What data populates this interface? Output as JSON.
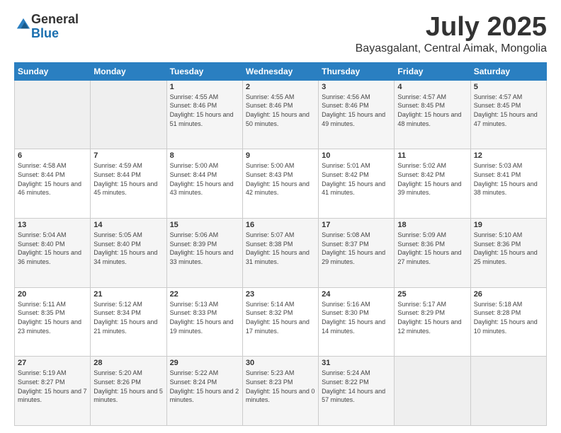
{
  "header": {
    "logo_general": "General",
    "logo_blue": "Blue",
    "month": "July 2025",
    "location": "Bayasgalant, Central Aimak, Mongolia"
  },
  "days_of_week": [
    "Sunday",
    "Monday",
    "Tuesday",
    "Wednesday",
    "Thursday",
    "Friday",
    "Saturday"
  ],
  "weeks": [
    [
      {
        "day": "",
        "sunrise": "",
        "sunset": "",
        "daylight": ""
      },
      {
        "day": "",
        "sunrise": "",
        "sunset": "",
        "daylight": ""
      },
      {
        "day": "1",
        "sunrise": "Sunrise: 4:55 AM",
        "sunset": "Sunset: 8:46 PM",
        "daylight": "Daylight: 15 hours and 51 minutes."
      },
      {
        "day": "2",
        "sunrise": "Sunrise: 4:55 AM",
        "sunset": "Sunset: 8:46 PM",
        "daylight": "Daylight: 15 hours and 50 minutes."
      },
      {
        "day": "3",
        "sunrise": "Sunrise: 4:56 AM",
        "sunset": "Sunset: 8:46 PM",
        "daylight": "Daylight: 15 hours and 49 minutes."
      },
      {
        "day": "4",
        "sunrise": "Sunrise: 4:57 AM",
        "sunset": "Sunset: 8:45 PM",
        "daylight": "Daylight: 15 hours and 48 minutes."
      },
      {
        "day": "5",
        "sunrise": "Sunrise: 4:57 AM",
        "sunset": "Sunset: 8:45 PM",
        "daylight": "Daylight: 15 hours and 47 minutes."
      }
    ],
    [
      {
        "day": "6",
        "sunrise": "Sunrise: 4:58 AM",
        "sunset": "Sunset: 8:44 PM",
        "daylight": "Daylight: 15 hours and 46 minutes."
      },
      {
        "day": "7",
        "sunrise": "Sunrise: 4:59 AM",
        "sunset": "Sunset: 8:44 PM",
        "daylight": "Daylight: 15 hours and 45 minutes."
      },
      {
        "day": "8",
        "sunrise": "Sunrise: 5:00 AM",
        "sunset": "Sunset: 8:44 PM",
        "daylight": "Daylight: 15 hours and 43 minutes."
      },
      {
        "day": "9",
        "sunrise": "Sunrise: 5:00 AM",
        "sunset": "Sunset: 8:43 PM",
        "daylight": "Daylight: 15 hours and 42 minutes."
      },
      {
        "day": "10",
        "sunrise": "Sunrise: 5:01 AM",
        "sunset": "Sunset: 8:42 PM",
        "daylight": "Daylight: 15 hours and 41 minutes."
      },
      {
        "day": "11",
        "sunrise": "Sunrise: 5:02 AM",
        "sunset": "Sunset: 8:42 PM",
        "daylight": "Daylight: 15 hours and 39 minutes."
      },
      {
        "day": "12",
        "sunrise": "Sunrise: 5:03 AM",
        "sunset": "Sunset: 8:41 PM",
        "daylight": "Daylight: 15 hours and 38 minutes."
      }
    ],
    [
      {
        "day": "13",
        "sunrise": "Sunrise: 5:04 AM",
        "sunset": "Sunset: 8:40 PM",
        "daylight": "Daylight: 15 hours and 36 minutes."
      },
      {
        "day": "14",
        "sunrise": "Sunrise: 5:05 AM",
        "sunset": "Sunset: 8:40 PM",
        "daylight": "Daylight: 15 hours and 34 minutes."
      },
      {
        "day": "15",
        "sunrise": "Sunrise: 5:06 AM",
        "sunset": "Sunset: 8:39 PM",
        "daylight": "Daylight: 15 hours and 33 minutes."
      },
      {
        "day": "16",
        "sunrise": "Sunrise: 5:07 AM",
        "sunset": "Sunset: 8:38 PM",
        "daylight": "Daylight: 15 hours and 31 minutes."
      },
      {
        "day": "17",
        "sunrise": "Sunrise: 5:08 AM",
        "sunset": "Sunset: 8:37 PM",
        "daylight": "Daylight: 15 hours and 29 minutes."
      },
      {
        "day": "18",
        "sunrise": "Sunrise: 5:09 AM",
        "sunset": "Sunset: 8:36 PM",
        "daylight": "Daylight: 15 hours and 27 minutes."
      },
      {
        "day": "19",
        "sunrise": "Sunrise: 5:10 AM",
        "sunset": "Sunset: 8:36 PM",
        "daylight": "Daylight: 15 hours and 25 minutes."
      }
    ],
    [
      {
        "day": "20",
        "sunrise": "Sunrise: 5:11 AM",
        "sunset": "Sunset: 8:35 PM",
        "daylight": "Daylight: 15 hours and 23 minutes."
      },
      {
        "day": "21",
        "sunrise": "Sunrise: 5:12 AM",
        "sunset": "Sunset: 8:34 PM",
        "daylight": "Daylight: 15 hours and 21 minutes."
      },
      {
        "day": "22",
        "sunrise": "Sunrise: 5:13 AM",
        "sunset": "Sunset: 8:33 PM",
        "daylight": "Daylight: 15 hours and 19 minutes."
      },
      {
        "day": "23",
        "sunrise": "Sunrise: 5:14 AM",
        "sunset": "Sunset: 8:32 PM",
        "daylight": "Daylight: 15 hours and 17 minutes."
      },
      {
        "day": "24",
        "sunrise": "Sunrise: 5:16 AM",
        "sunset": "Sunset: 8:30 PM",
        "daylight": "Daylight: 15 hours and 14 minutes."
      },
      {
        "day": "25",
        "sunrise": "Sunrise: 5:17 AM",
        "sunset": "Sunset: 8:29 PM",
        "daylight": "Daylight: 15 hours and 12 minutes."
      },
      {
        "day": "26",
        "sunrise": "Sunrise: 5:18 AM",
        "sunset": "Sunset: 8:28 PM",
        "daylight": "Daylight: 15 hours and 10 minutes."
      }
    ],
    [
      {
        "day": "27",
        "sunrise": "Sunrise: 5:19 AM",
        "sunset": "Sunset: 8:27 PM",
        "daylight": "Daylight: 15 hours and 7 minutes."
      },
      {
        "day": "28",
        "sunrise": "Sunrise: 5:20 AM",
        "sunset": "Sunset: 8:26 PM",
        "daylight": "Daylight: 15 hours and 5 minutes."
      },
      {
        "day": "29",
        "sunrise": "Sunrise: 5:22 AM",
        "sunset": "Sunset: 8:24 PM",
        "daylight": "Daylight: 15 hours and 2 minutes."
      },
      {
        "day": "30",
        "sunrise": "Sunrise: 5:23 AM",
        "sunset": "Sunset: 8:23 PM",
        "daylight": "Daylight: 15 hours and 0 minutes."
      },
      {
        "day": "31",
        "sunrise": "Sunrise: 5:24 AM",
        "sunset": "Sunset: 8:22 PM",
        "daylight": "Daylight: 14 hours and 57 minutes."
      },
      {
        "day": "",
        "sunrise": "",
        "sunset": "",
        "daylight": ""
      },
      {
        "day": "",
        "sunrise": "",
        "sunset": "",
        "daylight": ""
      }
    ]
  ]
}
